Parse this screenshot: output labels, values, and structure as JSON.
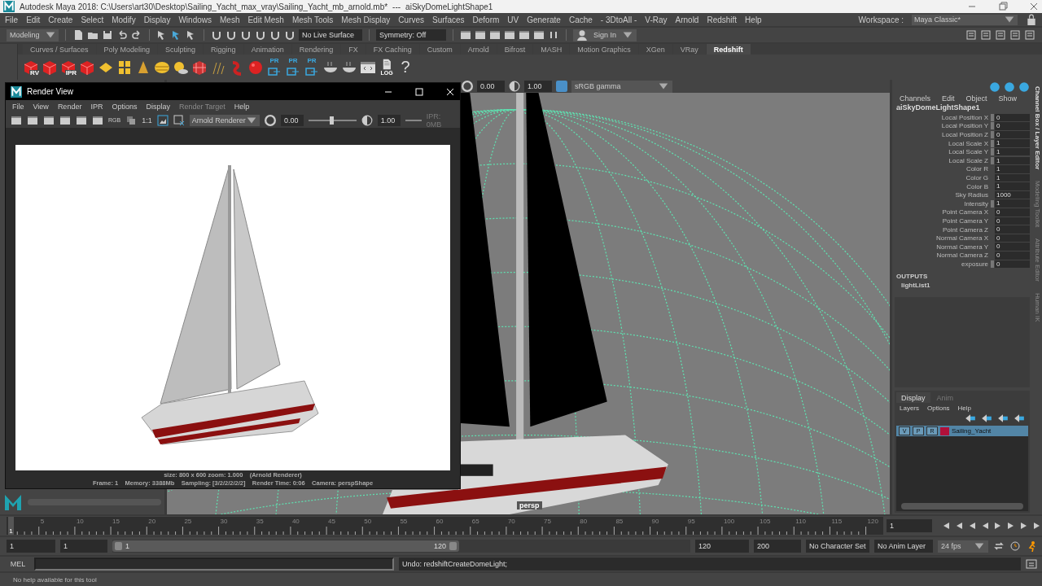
{
  "window": {
    "title": "Autodesk Maya 2018: C:\\Users\\art30\\Desktop\\Sailing_Yacht_max_vray\\Sailing_Yacht_mb_arnold.mb*",
    "separator": "---",
    "subtitle": "aiSkyDomeLightShape1"
  },
  "menu_bar": {
    "items": [
      "File",
      "Edit",
      "Create",
      "Select",
      "Modify",
      "Display",
      "Windows",
      "Mesh",
      "Edit Mesh",
      "Mesh Tools",
      "Mesh Display",
      "Curves",
      "Surfaces",
      "Deform",
      "UV",
      "Generate",
      "Cache",
      "- 3DtoAll -",
      "V-Ray",
      "Arnold",
      "Redshift",
      "Help"
    ],
    "workspace_label": "Workspace :",
    "workspace_value": "Maya Classic*"
  },
  "status_line": {
    "mode": "Modeling",
    "live_surface": "No Live Surface",
    "symmetry": "Symmetry: Off",
    "sign_in": "Sign In"
  },
  "shelf": {
    "tabs": [
      {
        "label": "Curves / Surfaces",
        "selected": false
      },
      {
        "label": "Poly Modeling",
        "selected": false
      },
      {
        "label": "Sculpting",
        "selected": false
      },
      {
        "label": "Rigging",
        "selected": false
      },
      {
        "label": "Animation",
        "selected": false
      },
      {
        "label": "Rendering",
        "selected": false
      },
      {
        "label": "FX",
        "selected": false
      },
      {
        "label": "FX Caching",
        "selected": false
      },
      {
        "label": "Custom",
        "selected": false
      },
      {
        "label": "Arnold",
        "selected": false
      },
      {
        "label": "Bifrost",
        "selected": false
      },
      {
        "label": "MASH",
        "selected": false
      },
      {
        "label": "Motion Graphics",
        "selected": false
      },
      {
        "label": "XGen",
        "selected": false
      },
      {
        "label": "VRay",
        "selected": false
      },
      {
        "label": "Redshift",
        "selected": true
      }
    ],
    "buttons": [
      {
        "kind": "cube",
        "label": "RV"
      },
      {
        "kind": "cube"
      },
      {
        "kind": "cube",
        "label": "IPR"
      },
      {
        "kind": "cube"
      },
      {
        "kind": "plane"
      },
      {
        "kind": "tiles"
      },
      {
        "kind": "cone"
      },
      {
        "kind": "disc"
      },
      {
        "kind": "sun"
      },
      {
        "kind": "grid"
      },
      {
        "kind": "strands"
      },
      {
        "kind": "worm"
      },
      {
        "kind": "ball"
      },
      {
        "kind": "pr",
        "label": "PR"
      },
      {
        "kind": "pr",
        "label": "PR"
      },
      {
        "kind": "pr",
        "label": "PR"
      },
      {
        "kind": "bowl"
      },
      {
        "kind": "bowl"
      },
      {
        "kind": "code"
      },
      {
        "kind": "log",
        "label": "LOG"
      },
      {
        "kind": "help",
        "label": "?"
      }
    ]
  },
  "render_view": {
    "title": "Render View",
    "menu": [
      {
        "label": "File",
        "disabled": false
      },
      {
        "label": "View",
        "disabled": false
      },
      {
        "label": "Render",
        "disabled": false
      },
      {
        "label": "IPR",
        "disabled": false
      },
      {
        "label": "Options",
        "disabled": false
      },
      {
        "label": "Display",
        "disabled": false
      },
      {
        "label": "Render Target",
        "disabled": true
      },
      {
        "label": "Help",
        "disabled": false
      }
    ],
    "rgb": "RGB",
    "ratio": "1:1",
    "renderer": "Arnold Renderer",
    "exposure": "0.00",
    "exposure_slider": {
      "level": 0.48
    },
    "gamma": "1.00",
    "ipr": "IPR: 0MB",
    "info": "size: 800 x 600 zoom: 1.000    (Arnold Renderer)",
    "stats": "Frame: 1    Memory: 3388Mb    Sampling: [3/2/2/2/2/2]    Render Time: 0:06    Camera: perspShape"
  },
  "viewport": {
    "exposure": "0.00",
    "gamma": "1.00",
    "color_space": "sRGB gamma",
    "camera": "persp"
  },
  "channel_box": {
    "menu": [
      "Channels",
      "Edit",
      "Object",
      "Show"
    ],
    "node": "aiSkyDomeLightShape1",
    "attributes": [
      {
        "label": "Local Position X",
        "value": "0",
        "marked": true
      },
      {
        "label": "Local Position Y",
        "value": "0",
        "marked": true
      },
      {
        "label": "Local Position Z",
        "value": "0",
        "marked": true
      },
      {
        "label": "Local Scale X",
        "value": "1",
        "marked": true
      },
      {
        "label": "Local Scale Y",
        "value": "1",
        "marked": true
      },
      {
        "label": "Local Scale Z",
        "value": "1",
        "marked": true
      },
      {
        "label": "Color R",
        "value": "1",
        "marked": false
      },
      {
        "label": "Color G",
        "value": "1",
        "marked": false
      },
      {
        "label": "Color B",
        "value": "1",
        "marked": false
      },
      {
        "label": "Sky Radius",
        "value": "1000",
        "marked": false
      },
      {
        "label": "Intensity",
        "value": "1",
        "marked": true
      },
      {
        "label": "Point Camera X",
        "value": "0",
        "marked": false
      },
      {
        "label": "Point Camera Y",
        "value": "0",
        "marked": false
      },
      {
        "label": "Point Camera Z",
        "value": "0",
        "marked": false
      },
      {
        "label": "Normal Camera X",
        "value": "0",
        "marked": false
      },
      {
        "label": "Normal Camera Y",
        "value": "0",
        "marked": false
      },
      {
        "label": "Normal Camera Z",
        "value": "0",
        "marked": false
      },
      {
        "label": "exposure",
        "value": "0",
        "marked": true
      }
    ],
    "outputs_heading": "OUTPUTS",
    "outputs": [
      "lightList1"
    ]
  },
  "side_tabs": [
    "Channel Box / Layer Editor",
    "Modeling Toolkit",
    "Attribute Editor",
    "Human IK"
  ],
  "layer_editor": {
    "tabs": [
      {
        "label": "Display",
        "selected": true
      },
      {
        "label": "Anim",
        "selected": false
      }
    ],
    "menu": [
      "Layers",
      "Options",
      "Help"
    ],
    "layers": [
      {
        "visible": "V",
        "playback": "P",
        "render": "R",
        "color": "#b0103a",
        "name": "Sailing_Yacht",
        "selected": true
      }
    ]
  },
  "timeline": {
    "current": "1",
    "level": 0,
    "labels": [
      "5",
      "10",
      "15",
      "20",
      "25",
      "30",
      "35",
      "40",
      "45",
      "50",
      "55",
      "60",
      "65",
      "70",
      "75",
      "80",
      "85",
      "90",
      "95",
      "100",
      "105",
      "110",
      "115",
      "120"
    ],
    "frame_field": "1"
  },
  "range": {
    "start": "1",
    "playback_start": "1",
    "slider_start": "1",
    "slider_end": "120",
    "level": 0.6,
    "playback_end": "120",
    "end": "200",
    "character_set": "No Character Set",
    "anim_layer": "No Anim Layer",
    "fps": "24 fps"
  },
  "command_line": {
    "language": "MEL",
    "result": "Undo: redshiftCreateDomeLight;"
  },
  "help_line": "No help available for this tool"
}
